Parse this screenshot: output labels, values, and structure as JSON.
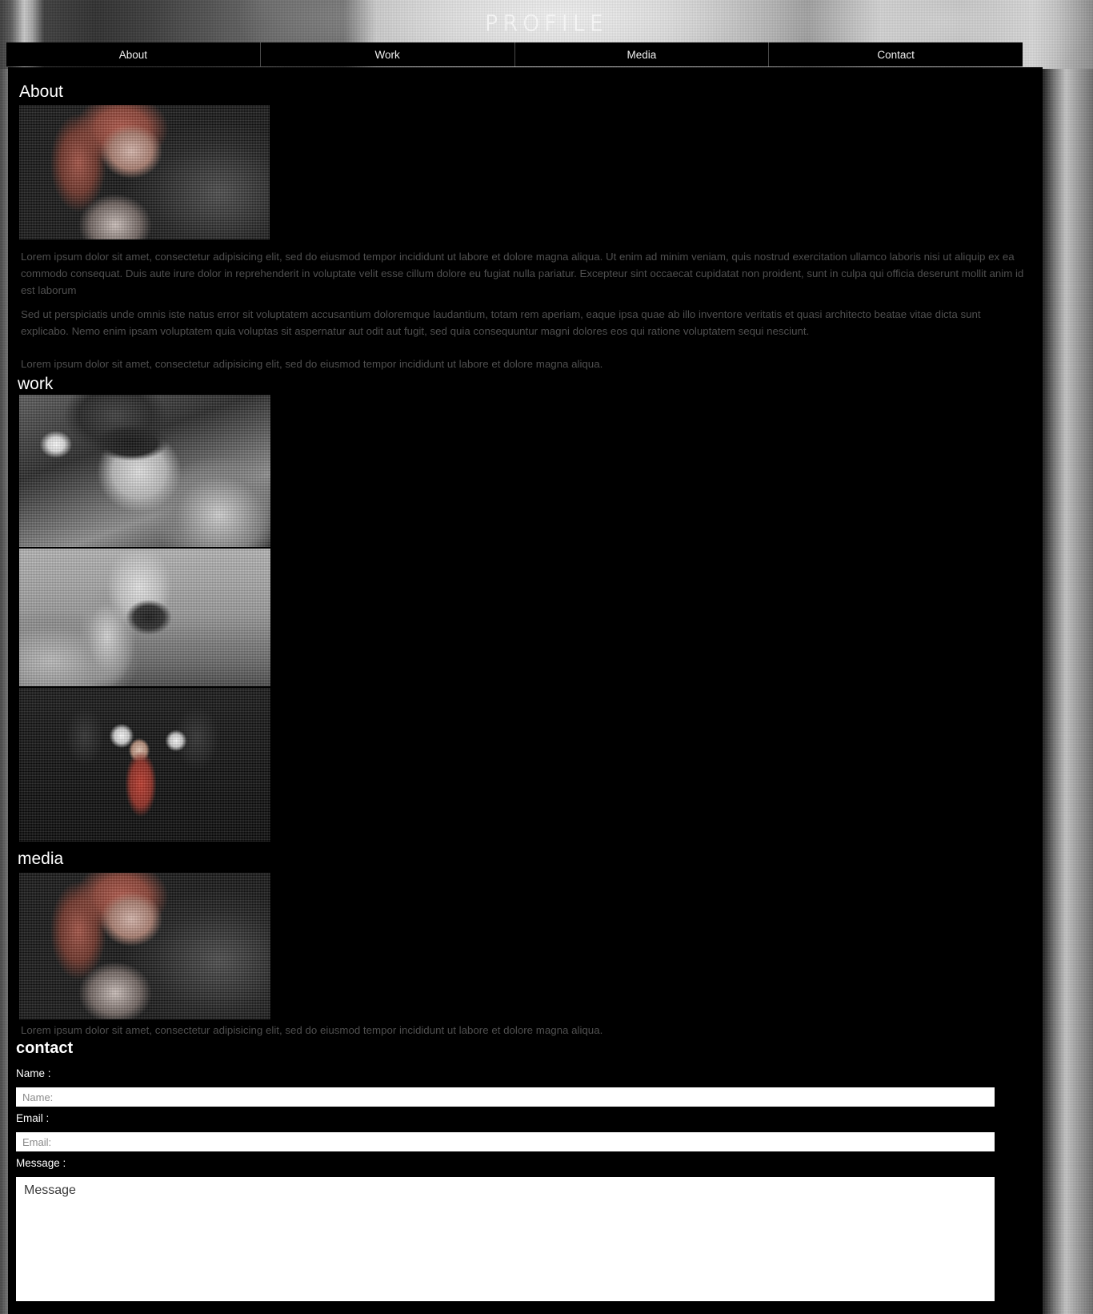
{
  "header": {
    "site_title": "PROFILE"
  },
  "nav": {
    "items": [
      {
        "label": "About"
      },
      {
        "label": "Work"
      },
      {
        "label": "Media"
      },
      {
        "label": "Contact"
      }
    ]
  },
  "sections": {
    "about": {
      "title": "About",
      "image_alt": "portrait-photo",
      "paragraphs": [
        "Lorem ipsum dolor sit amet, consectetur adipisicing elit, sed do eiusmod tempor incididunt ut labore et dolore magna aliqua. Ut enim ad minim veniam, quis nostrud exercitation ullamco laboris nisi ut aliquip ex ea commodo consequat. Duis aute irure dolor in reprehenderit in voluptate velit esse cillum dolore eu fugiat nulla pariatur. Excepteur sint occaecat cupidatat non proident, sunt in culpa qui officia deserunt mollit anim id est laborum",
        "Sed ut perspiciatis unde omnis iste natus error sit voluptatem accusantium doloremque laudantium, totam rem aperiam, eaque ipsa quae ab illo inventore veritatis et quasi architecto beatae vitae dicta sunt explicabo. Nemo enim ipsam voluptatem quia voluptas sit aspernatur aut odit aut fugit, sed quia consequuntur magni dolores eos qui ratione voluptatem sequi nesciunt.",
        "Lorem ipsum dolor sit amet, consectetur adipisicing elit, sed do eiusmod tempor incididunt ut labore et dolore magna aliqua."
      ]
    },
    "work": {
      "title": "work",
      "images": [
        {
          "alt": "model-with-sunglasses-photo"
        },
        {
          "alt": "girl-with-camera-photo"
        },
        {
          "alt": "red-dress-paparazzi-photo"
        }
      ]
    },
    "media": {
      "title": "media",
      "image_alt": "portrait-photo",
      "paragraph": "Lorem ipsum dolor sit amet, consectetur adipisicing elit, sed do eiusmod tempor incididunt ut labore et dolore magna aliqua."
    },
    "contact": {
      "title": "contact",
      "fields": {
        "name": {
          "label": "Name :",
          "placeholder": "Name:",
          "value": ""
        },
        "email": {
          "label": "Email :",
          "placeholder": "Email:",
          "value": ""
        },
        "message": {
          "label": "Message :",
          "value": "Message"
        }
      }
    }
  },
  "colors": {
    "panel_background": "#000000",
    "page_background": "#2e2e2e",
    "heading_text": "#ffffff",
    "body_text": "#4f4f4f",
    "nav_background": "#000000",
    "input_background": "#ffffff",
    "placeholder_text": "#8a8a8a"
  }
}
